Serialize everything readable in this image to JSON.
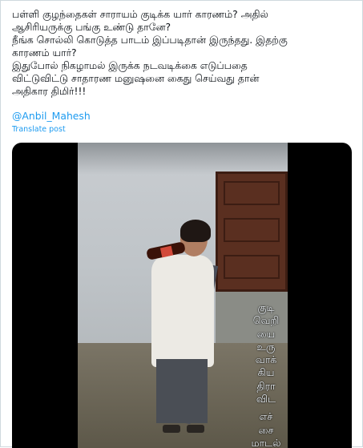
{
  "tweet": {
    "text": "பள்ளி குழந்தைகள் சாராயம் குடிக்க யார் காரணம்? அதில்\nஆசிரியருக்கு பங்கு உண்டு தானே?\nநீங்க சொல்லி கொடுத்த பாடம் இப்படிதான் இருந்தது. இதற்கு\nகாரணம் யார்?\nஇதுபோல் நிகழாமல் இருக்க நடவடிக்கை எடுப்பதை\nவிட்டுவிட்டு சாதாரண மனுஷனை கைது செய்வது தான்\nஅதிகார திமிர்!!!",
    "mention": "@Anbil_Mahesh",
    "translate_label": "Translate post"
  },
  "media": {
    "overlay_lines": [
      "குடி",
      "வெறி",
      "யை",
      "உரு",
      "வாக்",
      "கிய",
      "திரா",
      "விட",
      "",
      "எச்",
      "சை",
      "மாடல்"
    ]
  },
  "colors": {
    "text": "#0f1419",
    "link": "#1d9bf0",
    "border": "#cfd9de"
  }
}
